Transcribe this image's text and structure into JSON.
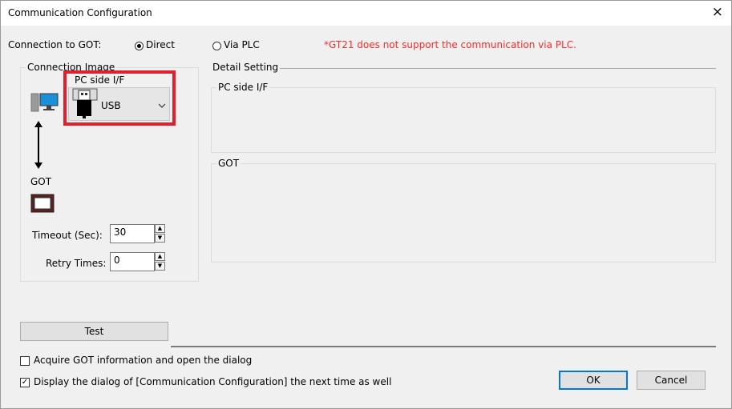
{
  "window": {
    "title": "Communication Configuration",
    "close_icon": "×"
  },
  "connection": {
    "label": "Connection to GOT:",
    "option_direct": "Direct",
    "option_via_plc": "Via PLC",
    "warning": "*GT21 does not support the communication via PLC.",
    "selected": "Direct"
  },
  "connection_image": {
    "legend": "Connection Image",
    "pc_side_label": "PC side I/F",
    "pc_side_value": "USB",
    "got_label": "GOT",
    "highlight_color": "#e0202b"
  },
  "timeout": {
    "label": "Timeout (Sec):",
    "value": "30"
  },
  "retry": {
    "label": "Retry Times:",
    "value": "0"
  },
  "detail": {
    "legend": "Detail Setting",
    "pc_side_label": "PC side I/F",
    "got_label": "GOT"
  },
  "buttons": {
    "test": "Test",
    "ok": "OK",
    "cancel": "Cancel"
  },
  "options": {
    "acquire_info": "Acquire GOT information and open the dialog",
    "display_next": "Display the dialog of [Communication Configuration] the next time as well",
    "acquire_checked": false,
    "display_checked": true
  }
}
